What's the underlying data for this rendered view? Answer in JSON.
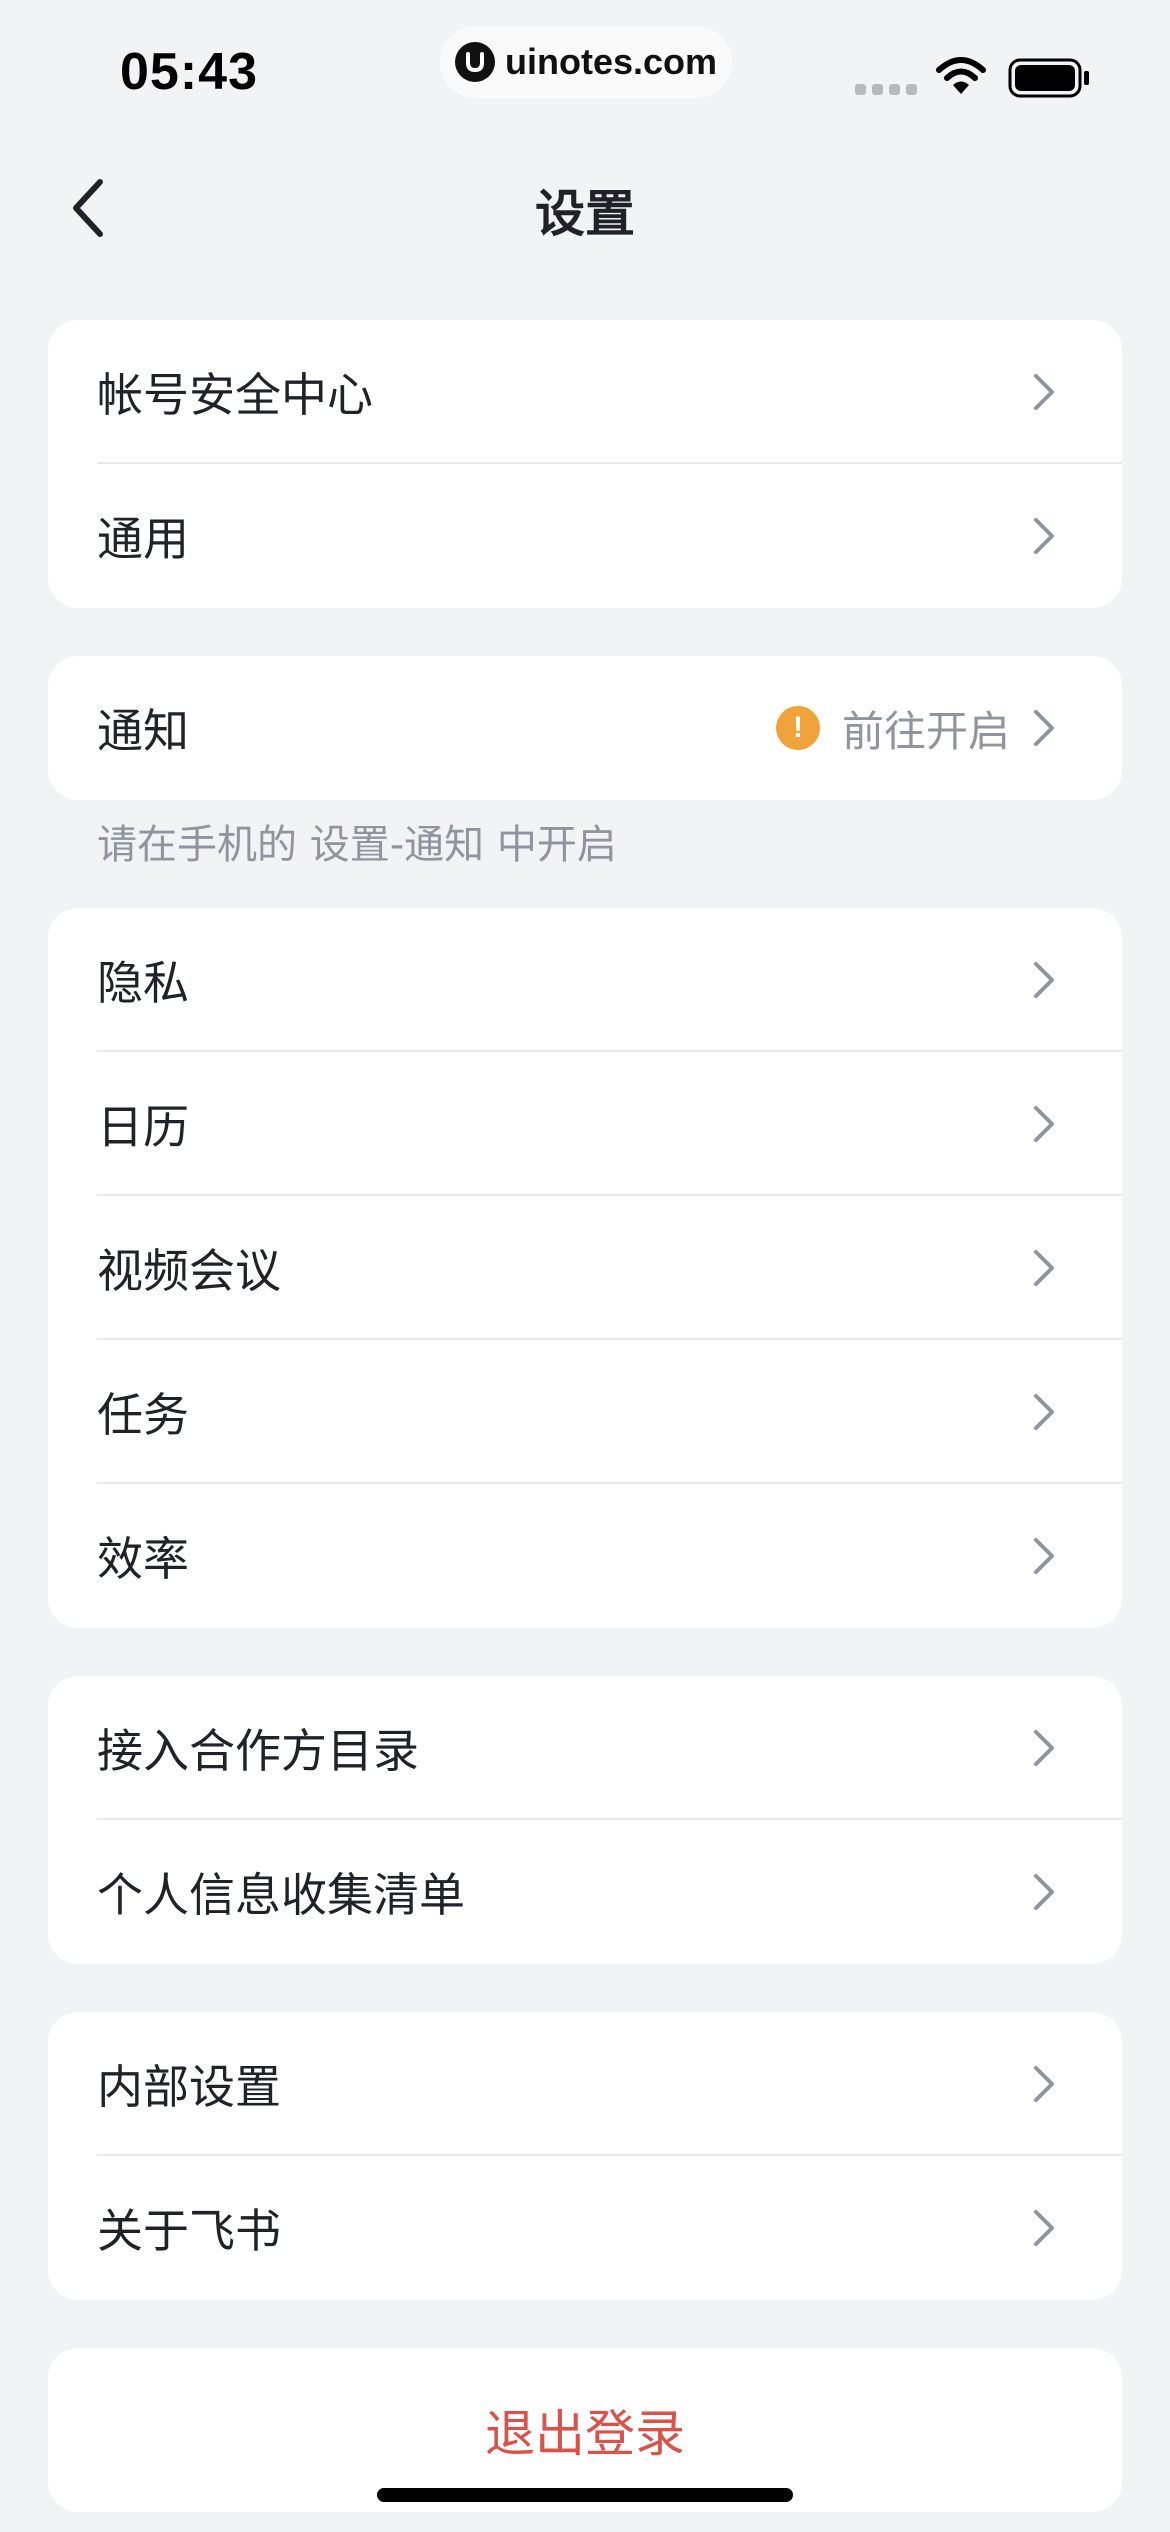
{
  "status_bar": {
    "time": "05:43",
    "watermark": "uinotes.com"
  },
  "nav": {
    "title": "设置"
  },
  "groups": [
    {
      "items": [
        {
          "label": "帐号安全中心"
        },
        {
          "label": "通用"
        }
      ]
    },
    {
      "items": [
        {
          "label": "通知",
          "status_text": "前往开启"
        }
      ]
    },
    {
      "items": [
        {
          "label": "隐私"
        },
        {
          "label": "日历"
        },
        {
          "label": "视频会议"
        },
        {
          "label": "任务"
        },
        {
          "label": "效率"
        }
      ]
    },
    {
      "items": [
        {
          "label": "接入合作方目录"
        },
        {
          "label": "个人信息收集清单"
        }
      ]
    },
    {
      "items": [
        {
          "label": "内部设置"
        },
        {
          "label": "关于飞书"
        }
      ]
    }
  ],
  "notification_hint": "请在手机的 设置-通知 中开启",
  "logout": {
    "label": "退出登录"
  },
  "colors": {
    "background": "#f2f3f5",
    "warning": "#f0a33a",
    "logout": "#d9534a",
    "secondary_text": "#8f959e"
  }
}
